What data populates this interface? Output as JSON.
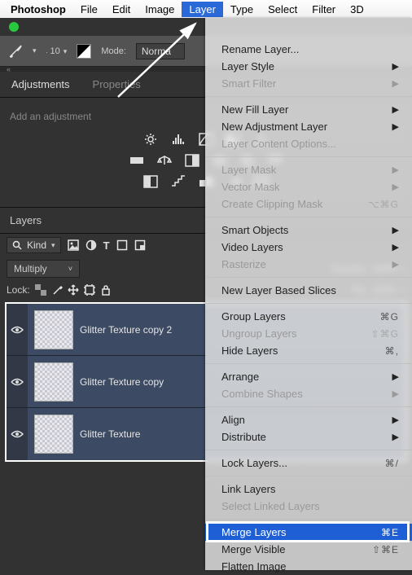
{
  "menubar": [
    "Photoshop",
    "File",
    "Edit",
    "Image",
    "Layer",
    "Type",
    "Select",
    "Filter",
    "3D"
  ],
  "menubar_active_index": 4,
  "options_bar": {
    "size": "10",
    "mode_label": "Mode:",
    "mode_value": "Norma"
  },
  "tabs": {
    "adjustments": "Adjustments",
    "properties": "Properties"
  },
  "adjustments_hint": "Add an adjustment",
  "layers_panel": {
    "title": "Layers",
    "kind_label": "Kind",
    "blend_mode": "Multiply",
    "opacity_label": "Opacity:",
    "opacity_value": "100%",
    "lock_label": "Lock:",
    "fill_label": "Fill:",
    "fill_value": "100%",
    "layers": [
      {
        "name": "Glitter Texture copy 2"
      },
      {
        "name": "Glitter Texture copy"
      },
      {
        "name": "Glitter Texture"
      }
    ]
  },
  "menu": [
    {
      "label": "Rename Layer..."
    },
    {
      "label": "Layer Style",
      "sub": true
    },
    {
      "label": "Smart Filter",
      "sub": true,
      "disabled": true
    },
    {
      "sep": true
    },
    {
      "label": "New Fill Layer",
      "sub": true
    },
    {
      "label": "New Adjustment Layer",
      "sub": true
    },
    {
      "label": "Layer Content Options...",
      "disabled": true
    },
    {
      "sep": true
    },
    {
      "label": "Layer Mask",
      "sub": true,
      "disabled": true
    },
    {
      "label": "Vector Mask",
      "sub": true,
      "disabled": true
    },
    {
      "label": "Create Clipping Mask",
      "shortcut": "⌥⌘G",
      "disabled": true
    },
    {
      "sep": true
    },
    {
      "label": "Smart Objects",
      "sub": true
    },
    {
      "label": "Video Layers",
      "sub": true
    },
    {
      "label": "Rasterize",
      "sub": true,
      "disabled": true
    },
    {
      "sep": true
    },
    {
      "label": "New Layer Based Slices"
    },
    {
      "sep": true
    },
    {
      "label": "Group Layers",
      "shortcut": "⌘G"
    },
    {
      "label": "Ungroup Layers",
      "shortcut": "⇧⌘G",
      "disabled": true
    },
    {
      "label": "Hide Layers",
      "shortcut": "⌘,"
    },
    {
      "sep": true
    },
    {
      "label": "Arrange",
      "sub": true
    },
    {
      "label": "Combine Shapes",
      "sub": true,
      "disabled": true
    },
    {
      "sep": true
    },
    {
      "label": "Align",
      "sub": true
    },
    {
      "label": "Distribute",
      "sub": true
    },
    {
      "sep": true
    },
    {
      "label": "Lock Layers...",
      "shortcut": "⌘/"
    },
    {
      "sep": true
    },
    {
      "label": "Link Layers"
    },
    {
      "label": "Select Linked Layers",
      "disabled": true
    },
    {
      "sep": true
    },
    {
      "label": "Merge Layers",
      "shortcut": "⌘E",
      "selected": true
    },
    {
      "label": "Merge Visible",
      "shortcut": "⇧⌘E"
    },
    {
      "label": "Flatten Image"
    }
  ]
}
